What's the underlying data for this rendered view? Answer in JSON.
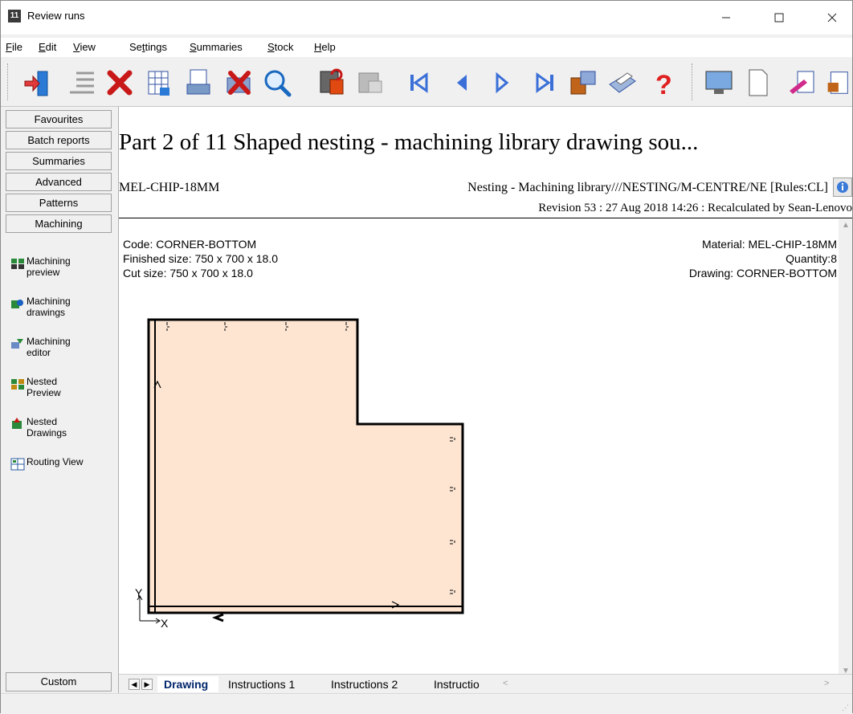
{
  "window": {
    "title": "Review runs",
    "icon_text": "11",
    "controls": [
      "minimize-icon",
      "maximize-icon",
      "close-icon"
    ]
  },
  "menu": [
    {
      "label": "File",
      "ul": "F",
      "rest": "ile"
    },
    {
      "label": "Edit",
      "ul": "E",
      "rest": "dit"
    },
    {
      "label": "View",
      "ul": "V",
      "rest": "iew"
    },
    {
      "label": "Settings",
      "ul": "t",
      "pre": "Se",
      "rest": "tings"
    },
    {
      "label": "Summaries",
      "ul": "S",
      "rest": "ummaries"
    },
    {
      "label": "Stock",
      "ul": "S",
      "rest": "tock"
    },
    {
      "label": "Help",
      "ul": "H",
      "rest": "elp"
    }
  ],
  "toolbar": {
    "buttons": [
      "exit-icon",
      "list-icon",
      "delete-icon",
      "grid-report-icon",
      "print-grid-icon",
      "delete-print-icon",
      "search-icon",
      "calculator-icon",
      "report-icon",
      "first-icon",
      "previous-icon",
      "next-icon",
      "last-icon",
      "export-icon",
      "printer-icon",
      "help-icon",
      "monitor-icon",
      "blank-page-icon",
      "edit-report-icon",
      "more-icon"
    ]
  },
  "left_nav": {
    "tabs": [
      "Favourites",
      "Batch reports",
      "Summaries",
      "Advanced",
      "Patterns",
      "Machining"
    ],
    "items": [
      {
        "line1": "Machining",
        "line2": "preview",
        "icon": "machining-preview-icon"
      },
      {
        "line1": "Machining",
        "line2": "drawings",
        "icon": "machining-drawings-icon"
      },
      {
        "line1": "Machining",
        "line2": "editor",
        "icon": "machining-editor-icon"
      },
      {
        "line1": "Nested",
        "line2": "Preview",
        "icon": "nested-preview-icon"
      },
      {
        "line1": "Nested",
        "line2": "Drawings",
        "icon": "nested-drawings-icon"
      },
      {
        "line1": "Routing View",
        "line2": "",
        "icon": "routing-view-icon"
      }
    ],
    "custom": "Custom"
  },
  "header": {
    "title": "Part 2 of 11   Shaped nesting - machining library drawing sou...",
    "material_code": "MEL-CHIP-18MM",
    "library": "Nesting - Machining library///NESTING/M-CENTRE/NE [Rules:CL]",
    "revision": "Revision 53 : 27 Aug 2018 14:26 : Recalculated by Sean-Lenovo"
  },
  "part": {
    "code": "Code: CORNER-BOTTOM",
    "finished": "Finished size: 750 x 700 x  18.0",
    "cut": "Cut size: 750 x 700 x  18.0",
    "material": "Material: MEL-CHIP-18MM",
    "quantity": "Quantity:8",
    "drawing": "Drawing: CORNER-BOTTOM",
    "axis_y": "Y",
    "axis_x": "X"
  },
  "tabs": [
    "Drawing",
    "Instructions 1",
    "Instructions 2",
    "Instructio"
  ],
  "colors": {
    "part_fill": "#fde5d2",
    "active_tab_text": "#00266b"
  }
}
